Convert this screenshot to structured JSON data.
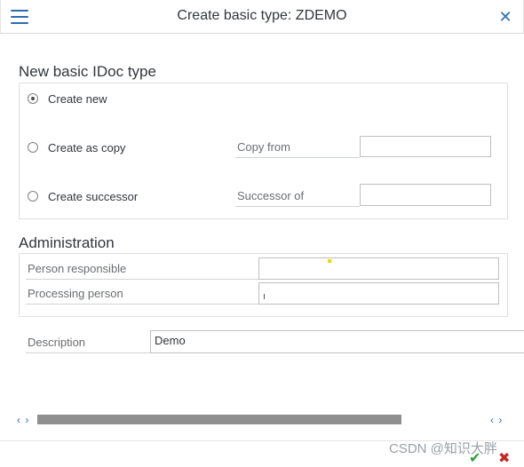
{
  "dialog": {
    "title": "Create basic type: ZDEMO",
    "menu_icon": "hamburger-menu-icon",
    "close_icon": "close-icon"
  },
  "new_basic_idoc": {
    "heading": "New basic IDoc type",
    "options": [
      {
        "label": "Create new",
        "selected": true
      },
      {
        "label": "Create as copy",
        "selected": false
      },
      {
        "label": "Create successor",
        "selected": false
      }
    ],
    "copy_from": {
      "label": "Copy from",
      "value": ""
    },
    "successor_of": {
      "label": "Successor of",
      "value": ""
    }
  },
  "administration": {
    "heading": "Administration",
    "person_responsible": {
      "label": "Person responsible",
      "value": ""
    },
    "processing_person": {
      "label": "Processing person",
      "value": ""
    }
  },
  "description": {
    "label": "Description",
    "value": "Demo"
  },
  "scroll": {
    "left_label": "‹ ›",
    "right_label": "‹ ›"
  },
  "footer": {
    "watermark": "CSDN @知识大胖",
    "ok_icon": "checkmark-icon",
    "cancel_icon": "cancel-x-icon"
  },
  "colors": {
    "accent": "#2b6cb0",
    "ok": "#2b9e3a",
    "cancel": "#c62828"
  }
}
